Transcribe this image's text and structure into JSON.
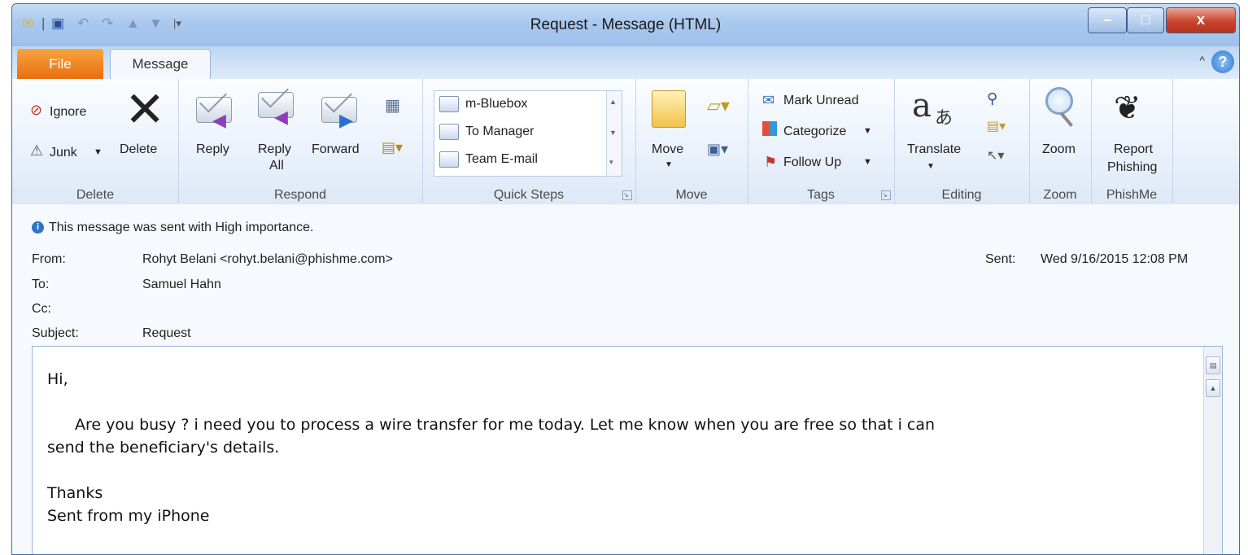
{
  "window": {
    "title": "Request - Message (HTML)",
    "controls": {
      "minimize": "–",
      "maximize": "□",
      "close": "x"
    }
  },
  "tabs": {
    "file": "File",
    "message": "Message",
    "help": "?",
    "minimize_ribbon": "^"
  },
  "ribbon": {
    "delete_group": {
      "label": "Delete",
      "ignore": "Ignore",
      "junk": "Junk",
      "delete": "Delete"
    },
    "respond_group": {
      "label": "Respond",
      "reply": "Reply",
      "reply_all_1": "Reply",
      "reply_all_2": "All",
      "forward": "Forward"
    },
    "quick_steps": {
      "label": "Quick Steps",
      "items": [
        "m-Bluebox",
        "To Manager",
        "Team E-mail"
      ]
    },
    "move_group": {
      "label": "Move",
      "move": "Move"
    },
    "tags_group": {
      "label": "Tags",
      "mark_unread": "Mark Unread",
      "categorize": "Categorize",
      "follow_up": "Follow Up"
    },
    "editing_group": {
      "label": "Editing",
      "translate": "Translate"
    },
    "zoom_group": {
      "label": "Zoom",
      "zoom": "Zoom"
    },
    "phishme_group": {
      "label": "PhishMe",
      "report_1": "Report",
      "report_2": "Phishing"
    }
  },
  "message": {
    "importance": "This message was sent with High importance.",
    "from_label": "From:",
    "from": "Rohyt Belani <rohyt.belani@phishme.com>",
    "to_label": "To:",
    "to": "Samuel Hahn",
    "cc_label": "Cc:",
    "cc": "",
    "subject_label": "Subject:",
    "subject": "Request",
    "sent_label": "Sent:",
    "sent": "Wed 9/16/2015 12:08 PM",
    "body": {
      "greeting": "Hi,",
      "line1": "Are you busy ? i need you to process a wire transfer for me today. Let me know when you are free so that i can",
      "line2": "send the beneficiary's details.",
      "thanks": "Thanks",
      "signature": "Sent from my iPhone"
    }
  },
  "colors": {
    "file_tab": "#e86e10",
    "title_bar": "#a9c8ee",
    "close_button": "#c9442c"
  }
}
